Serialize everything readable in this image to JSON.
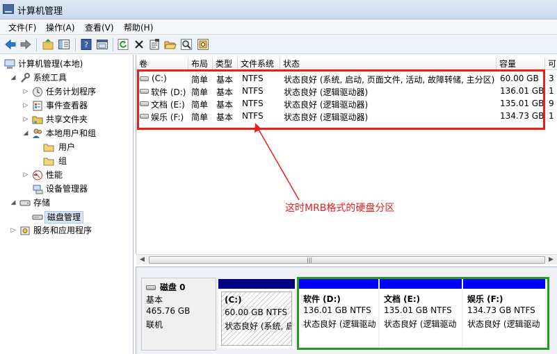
{
  "window": {
    "title": "计算机管理"
  },
  "menu": [
    "文件(F)",
    "操作(A)",
    "查看(V)",
    "帮助(H)"
  ],
  "toolbar": {
    "icons": [
      "back-icon",
      "forward-icon",
      "up-folder-icon",
      "show-hide-tree-icon",
      "help-icon",
      "console-view-icon",
      "refresh-icon",
      "delete-icon",
      "properties-icon",
      "open-icon",
      "search-icon",
      "settings-icon"
    ]
  },
  "tree": {
    "root": "计算机管理(本地)",
    "system_tools": "系统工具",
    "task_scheduler": "任务计划程序",
    "event_viewer": "事件查看器",
    "shared_folders": "共享文件夹",
    "local_users": "本地用户和组",
    "users": "用户",
    "groups": "组",
    "performance": "性能",
    "device_manager": "设备管理器",
    "storage": "存储",
    "disk_management": "磁盘管理",
    "services": "服务和应用程序"
  },
  "volume_list": {
    "columns": [
      "卷",
      "布局",
      "类型",
      "文件系统",
      "状态",
      "容量",
      "可"
    ],
    "rows": [
      {
        "volume": "(C:)",
        "layout": "简单",
        "type": "基本",
        "fs": "NTFS",
        "status": "状态良好 (系统, 启动, 页面文件, 活动, 故障转储, 主分区)",
        "capacity": "60.00 GB",
        "free": "3"
      },
      {
        "volume": "软件 (D:)",
        "layout": "简单",
        "type": "基本",
        "fs": "NTFS",
        "status": "状态良好 (逻辑驱动器)",
        "capacity": "136.01 GB",
        "free": "1"
      },
      {
        "volume": "文档 (E:)",
        "layout": "简单",
        "type": "基本",
        "fs": "NTFS",
        "status": "状态良好 (逻辑驱动器)",
        "capacity": "135.01 GB",
        "free": "9"
      },
      {
        "volume": "娱乐 (F:)",
        "layout": "简单",
        "type": "基本",
        "fs": "NTFS",
        "status": "状态良好 (逻辑驱动器)",
        "capacity": "134.73 GB",
        "free": "1"
      }
    ]
  },
  "annotation": "这时MRB格式的硬盘分区",
  "disk": {
    "name": "磁盘 0",
    "kind": "基本",
    "size": "465.76 GB",
    "state": "联机",
    "partitions": [
      {
        "name": "(C:)",
        "size": "60.00 GB NTFS",
        "status": "状态良好 (系统, 启",
        "color": "#00007f"
      },
      {
        "name": "软件 (D:)",
        "size": "136.01 GB NTFS",
        "status": "状态良好 (逻辑驱动",
        "color": "#0000ff"
      },
      {
        "name": "文档 (E:)",
        "size": "135.01 GB NTFS",
        "status": "状态良好 (逻辑驱动",
        "color": "#0000ff"
      },
      {
        "name": "娱乐 (F:)",
        "size": "134.73 GB NTFS",
        "status": "状态良好 (逻辑驱动",
        "color": "#0000ff"
      }
    ]
  },
  "colors": {
    "highlight_red": "#e8201c",
    "extended_green": "#249a24"
  }
}
